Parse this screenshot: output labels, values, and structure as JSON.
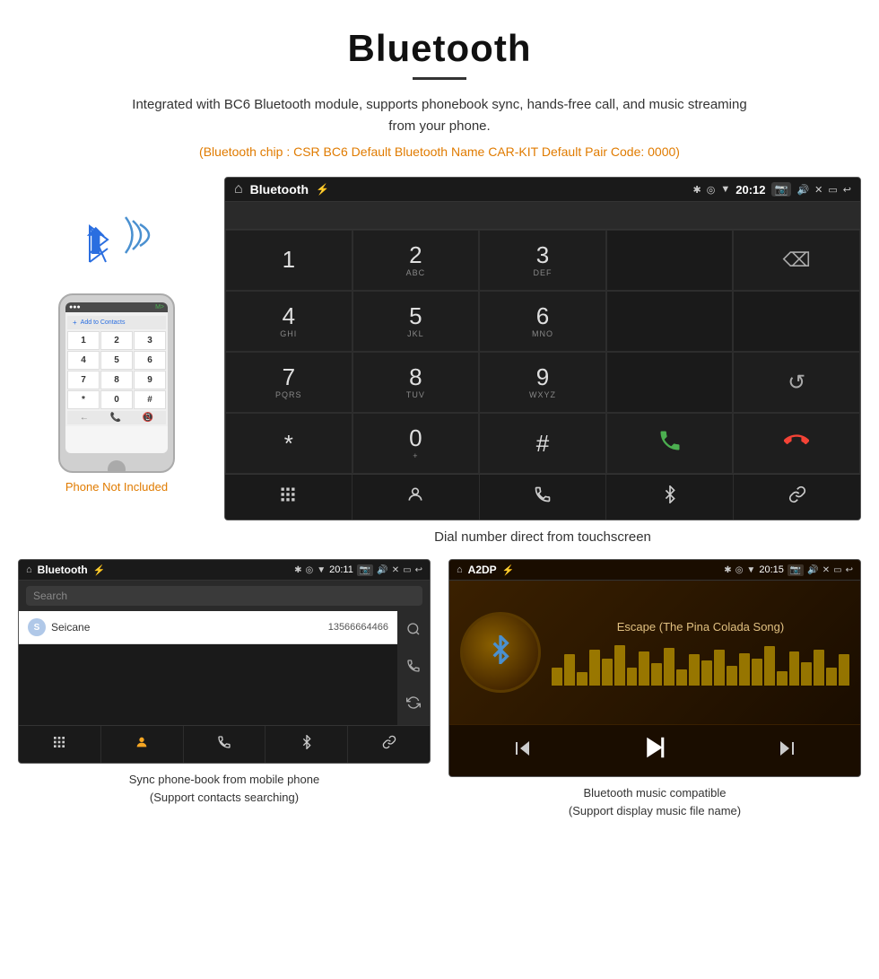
{
  "header": {
    "title": "Bluetooth",
    "description": "Integrated with BC6 Bluetooth module, supports phonebook sync, hands-free call, and music streaming from your phone.",
    "info_line": "(Bluetooth chip : CSR BC6    Default Bluetooth Name CAR-KIT    Default Pair Code: 0000)"
  },
  "dialer_screen": {
    "status_title": "Bluetooth",
    "status_time": "20:12",
    "keys": [
      {
        "num": "1",
        "sub": ""
      },
      {
        "num": "2",
        "sub": "ABC"
      },
      {
        "num": "3",
        "sub": "DEF"
      },
      {
        "num": "",
        "sub": ""
      },
      {
        "num": "⌫",
        "sub": ""
      },
      {
        "num": "4",
        "sub": "GHI"
      },
      {
        "num": "5",
        "sub": "JKL"
      },
      {
        "num": "6",
        "sub": "MNO"
      },
      {
        "num": "",
        "sub": ""
      },
      {
        "num": "",
        "sub": ""
      },
      {
        "num": "7",
        "sub": "PQRS"
      },
      {
        "num": "8",
        "sub": "TUV"
      },
      {
        "num": "9",
        "sub": "WXYZ"
      },
      {
        "num": "",
        "sub": ""
      },
      {
        "num": "↺",
        "sub": ""
      },
      {
        "num": "*",
        "sub": ""
      },
      {
        "num": "0",
        "sub": "+"
      },
      {
        "num": "#",
        "sub": ""
      },
      {
        "num": "📞",
        "sub": ""
      },
      {
        "num": "📵",
        "sub": ""
      }
    ],
    "bottom_nav": [
      "⊞",
      "👤",
      "📞",
      "✱",
      "🔗"
    ],
    "caption": "Dial number direct from touchscreen"
  },
  "phonebook_screen": {
    "status_title": "Bluetooth",
    "status_time": "20:11",
    "search_placeholder": "Search",
    "contacts": [
      {
        "letter": "S",
        "name": "Seicane",
        "number": "13566664466"
      }
    ],
    "right_icons": [
      "🔍",
      "📞",
      "↺"
    ],
    "bottom_nav": [
      "⊞",
      "👤",
      "📞",
      "✱",
      "🔗"
    ],
    "caption_line1": "Sync phone-book from mobile phone",
    "caption_line2": "(Support contacts searching)"
  },
  "music_screen": {
    "status_title": "A2DP",
    "status_time": "20:15",
    "song_title": "Escape (The Pina Colada Song)",
    "eq_heights": [
      20,
      35,
      15,
      40,
      30,
      45,
      20,
      38,
      25,
      42,
      18,
      35,
      28,
      40,
      22,
      36,
      30,
      44,
      16,
      38,
      26,
      40,
      20,
      35
    ],
    "controls": [
      "⏮",
      "⏯",
      "⏭"
    ],
    "caption_line1": "Bluetooth music compatible",
    "caption_line2": "(Support display music file name)"
  },
  "phone_section": {
    "not_included_label": "Phone Not Included"
  }
}
